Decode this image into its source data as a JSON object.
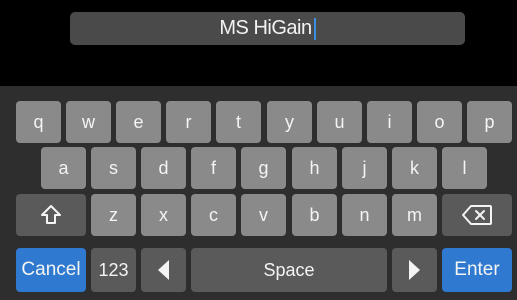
{
  "name_field": {
    "value": "MS HiGain"
  },
  "keyboard": {
    "row1": [
      "q",
      "w",
      "e",
      "r",
      "t",
      "y",
      "u",
      "i",
      "o",
      "p"
    ],
    "row2": [
      "a",
      "s",
      "d",
      "f",
      "g",
      "h",
      "j",
      "k",
      "l"
    ],
    "row3": [
      "z",
      "x",
      "c",
      "v",
      "b",
      "n",
      "m"
    ],
    "shift_icon": "shift-arrow-icon",
    "backspace_icon": "backspace-icon",
    "cancel_label": "Cancel",
    "numbers_label": "123",
    "cursor_left_icon": "triangle-left-icon",
    "space_label": "Space",
    "cursor_right_icon": "triangle-right-icon",
    "enter_label": "Enter"
  },
  "colors": {
    "background": "#000000",
    "keyboard_bg": "#2e2e2e",
    "key": "#8a8a8a",
    "function_key": "#5a5a5a",
    "accent": "#2f7ad0",
    "caret": "#3b8fe0"
  }
}
